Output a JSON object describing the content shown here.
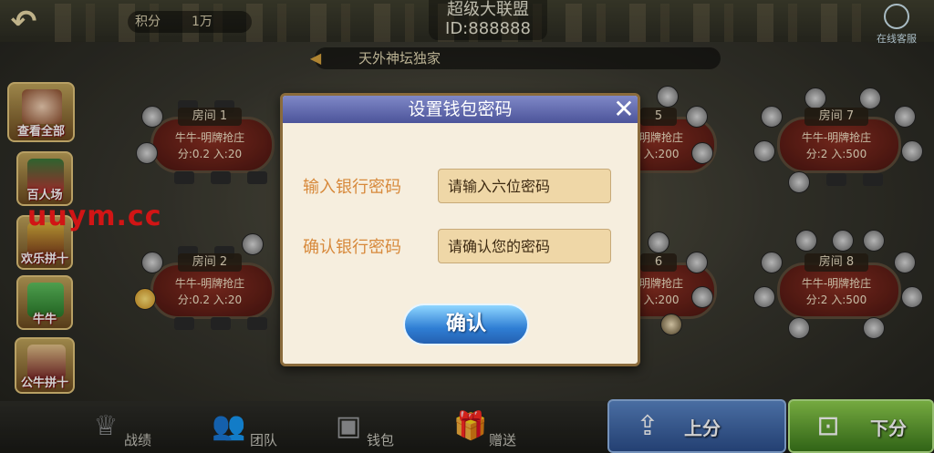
{
  "header": {
    "score_label": "积分",
    "score_value": "1万",
    "club_name": "超级大联盟",
    "club_id": "ID:888888",
    "service_label": "在线客服",
    "marquee_text": "天外神坛独家"
  },
  "left_menu": [
    {
      "label": "查看全部"
    },
    {
      "label": "百人场"
    },
    {
      "label": "欢乐拼十"
    },
    {
      "label": "牛牛"
    },
    {
      "label": "公牛拼十"
    }
  ],
  "tables": [
    {
      "room": "房间 1",
      "mode": "牛牛-明牌抢庄",
      "fee": "分:0.2   入:20"
    },
    {
      "room": "房间 2",
      "mode": "牛牛-明牌抢庄",
      "fee": "分:0.2   入:20"
    },
    {
      "room": "5",
      "mode": "明牌抢庄",
      "fee": "入:200"
    },
    {
      "room": "6",
      "mode": "明牌抢庄",
      "fee": "入:200"
    },
    {
      "room": "房间 7",
      "mode": "牛牛-明牌抢庄",
      "fee": "分:2    入:500"
    },
    {
      "room": "房间 8",
      "mode": "牛牛-明牌抢庄",
      "fee": "分:2    入:500"
    }
  ],
  "watermark": "uuym.cc",
  "bottom_nav": [
    {
      "label": "战绩",
      "icon": "trophy-icon"
    },
    {
      "label": "团队",
      "icon": "team-icon"
    },
    {
      "label": "钱包",
      "icon": "wallet-icon"
    },
    {
      "label": "赠送",
      "icon": "gift-icon"
    }
  ],
  "actions": {
    "up_label": "上分",
    "down_label": "下分"
  },
  "dialog": {
    "title": "设置钱包密码",
    "bank_password_label": "输入银行密码",
    "bank_password_placeholder": "请输入六位密码",
    "confirm_password_label": "确认银行密码",
    "confirm_password_placeholder": "请确认您的密码",
    "confirm_button": "确认"
  },
  "colors": {
    "dialog_header": "#5e66ad",
    "label_orange": "#d7893b",
    "input_bg": "#efd7a7",
    "confirm_blue": "#2f7ed4",
    "up_blue": "#3f69ac",
    "down_green": "#5fa32f",
    "watermark_red": "#ff1a1a"
  }
}
